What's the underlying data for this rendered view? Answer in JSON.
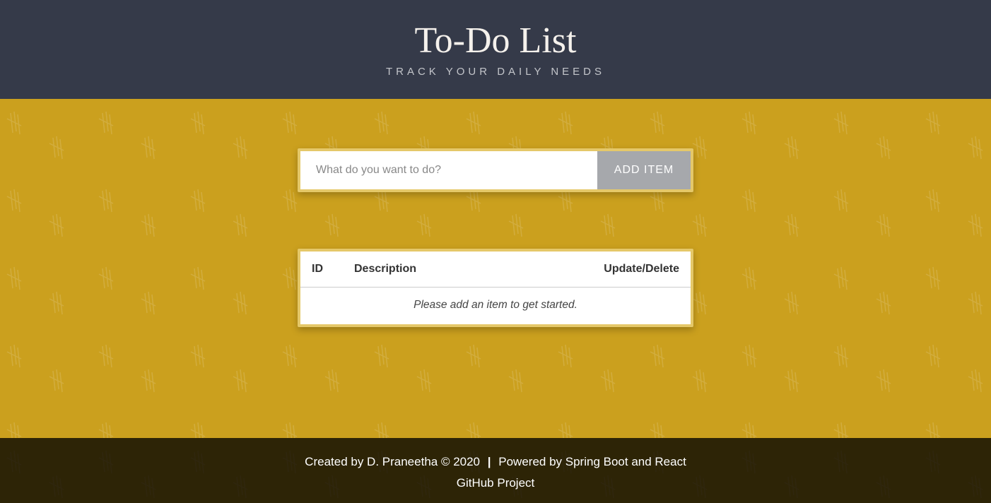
{
  "header": {
    "title": "To-Do List",
    "subtitle": "TRACK YOUR DAILY NEEDS"
  },
  "input": {
    "placeholder": "What do you want to do?",
    "button_label": "ADD ITEM"
  },
  "table": {
    "columns": {
      "id": "ID",
      "description": "Description",
      "actions": "Update/Delete"
    },
    "empty_message": "Please add an item to get started."
  },
  "footer": {
    "created_by": "Created by D. Praneetha © 2020",
    "separator": "|",
    "powered_by": "Powered by Spring Boot and React",
    "github_link": "GitHub Project"
  }
}
